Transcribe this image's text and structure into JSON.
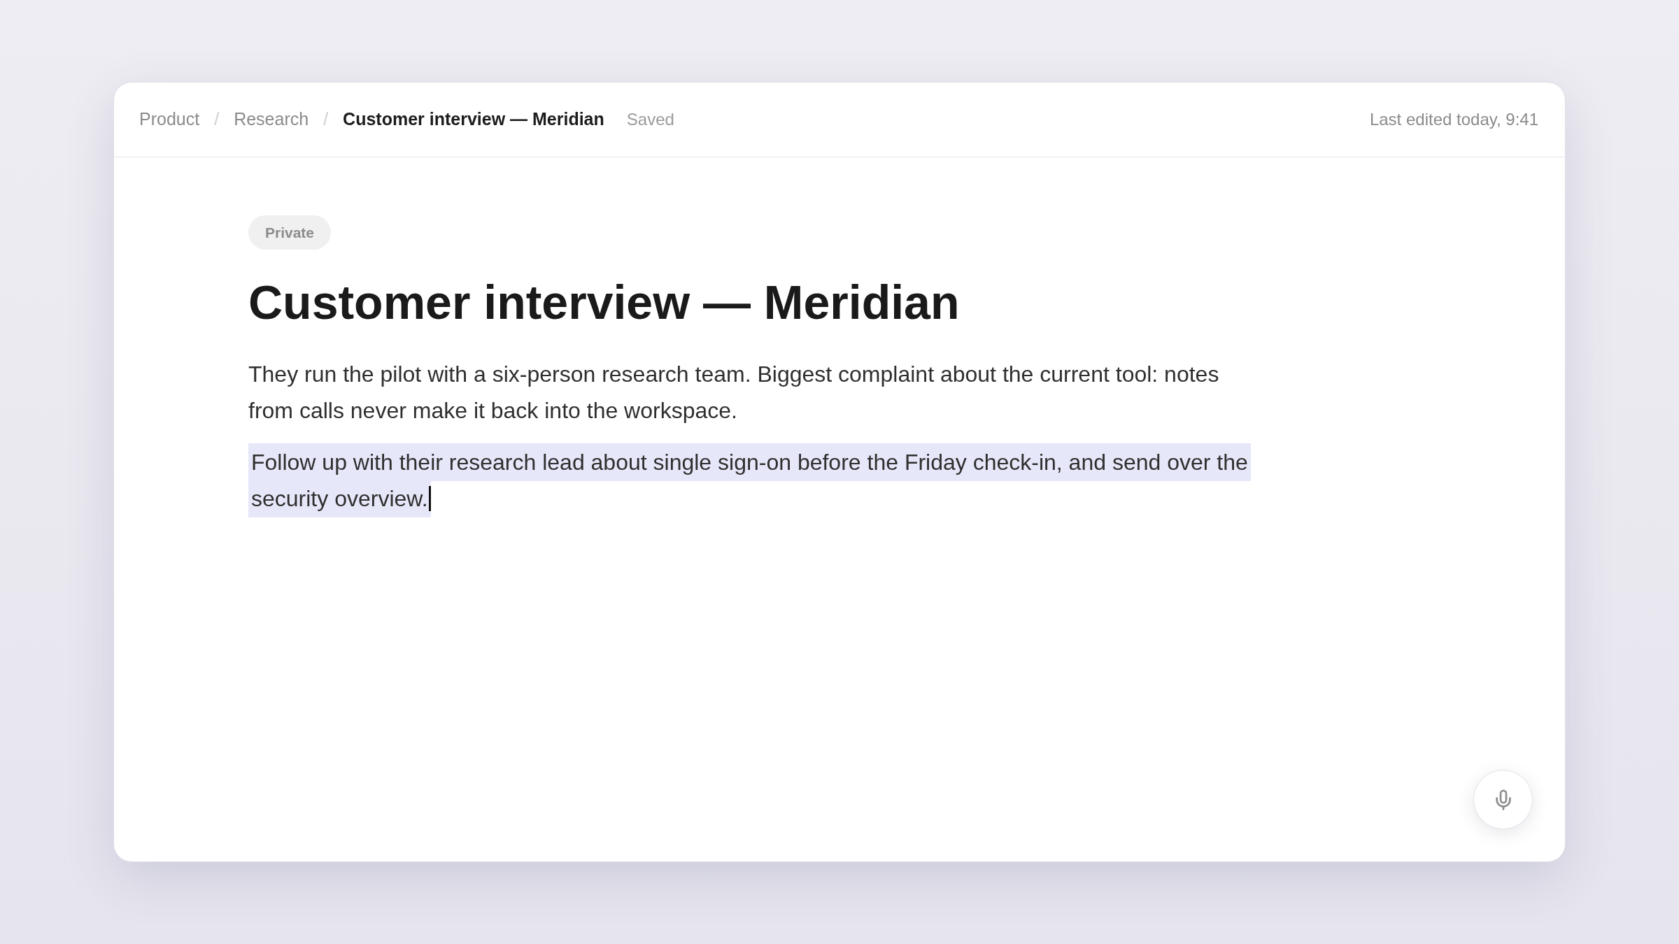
{
  "breadcrumb": {
    "items": [
      {
        "label": "Product",
        "current": false
      },
      {
        "separator": "/",
        "label": "Research",
        "current": false
      },
      {
        "separator": "/",
        "label": "Customer interview — Meridian",
        "current": true
      }
    ],
    "status": "Saved"
  },
  "last_edited": "Last edited today, 9:41",
  "document": {
    "badge": "Private",
    "title": "Customer interview — Meridian",
    "paragraphs": [
      {
        "text": "They run the pilot with a six-person research team. Biggest complaint about the current tool: notes from calls never make it back into the workspace.",
        "highlighted": false,
        "cursor": false
      },
      {
        "text": "Follow up with their research lead about single sign-on before the Friday check-in, and send over the security overview.",
        "highlighted": true,
        "cursor": true
      }
    ]
  }
}
